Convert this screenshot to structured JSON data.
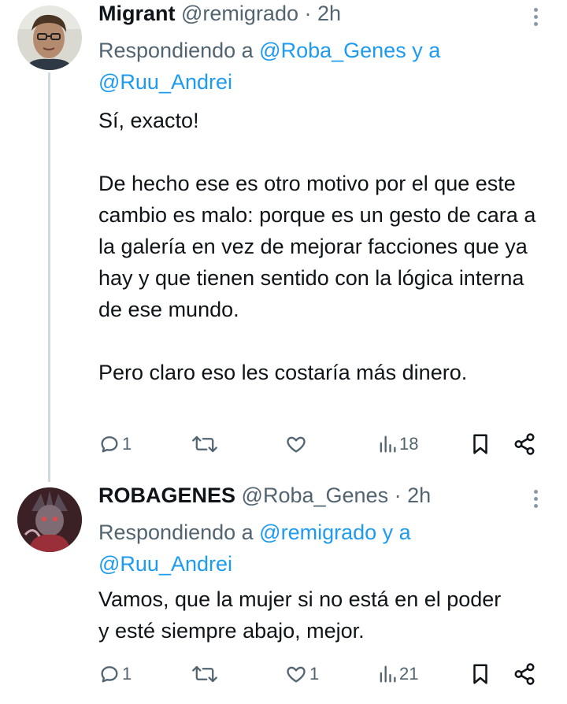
{
  "tweets": [
    {
      "display_name": "Migrant",
      "handle": "@remigrado",
      "separator": "·",
      "time": "2h",
      "replying_prefix": "Respondiendo a ",
      "replying_user1": "@Roba_Genes",
      "replying_and": " y a",
      "replying_user2": "@Ruu_Andrei",
      "body": [
        "Sí, exacto!",
        "",
        "De hecho ese es otro motivo por el que este cambio es malo: porque es un gesto de cara a la galería en vez de mejorar facciones que ya hay y que tienen sentido con la lógica interna de ese mundo.",
        "",
        "Pero claro eso les costaría más dinero."
      ],
      "replies": "1",
      "retweets": "",
      "likes": "",
      "views": "18",
      "icons": [
        "reply-icon",
        "retweet-icon",
        "like-icon",
        "views-icon",
        "bookmark-icon",
        "share-icon"
      ]
    },
    {
      "display_name": "ROBAGENES",
      "handle": "@Roba_Genes",
      "separator": "·",
      "time": "2h",
      "replying_prefix": "Respondiendo a ",
      "replying_user1": "@remigrado",
      "replying_and": " y a",
      "replying_user2": "@Ruu_Andrei",
      "body": [
        "Vamos, que la mujer si no está en el poder y esté siempre abajo, mejor."
      ],
      "replies": "1",
      "retweets": "",
      "likes": "1",
      "views": "21",
      "icons": [
        "reply-icon",
        "retweet-icon",
        "like-icon",
        "views-icon",
        "bookmark-icon",
        "share-icon"
      ]
    }
  ],
  "colors": {
    "link": "#1d9bf0",
    "meta": "#536471",
    "text": "#0f1419",
    "thread_line": "#cfd9de"
  }
}
